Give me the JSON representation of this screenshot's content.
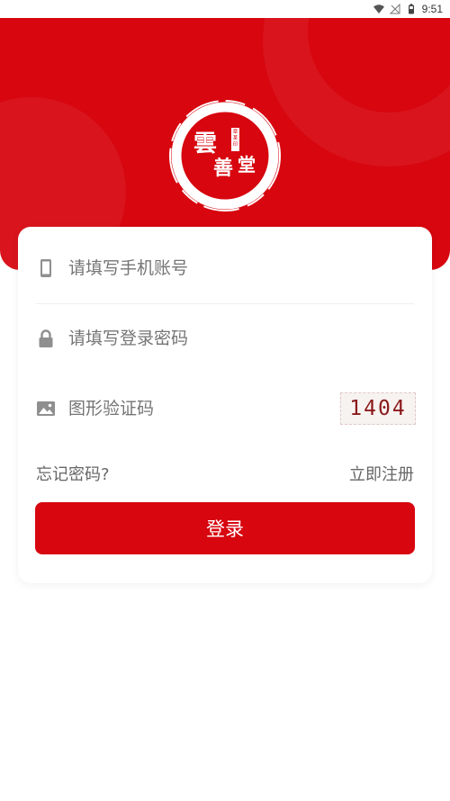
{
  "status_bar": {
    "time": "9:51"
  },
  "logo": {
    "calligraphy_main": "雲善堂",
    "calligraphy_seal": "章某印"
  },
  "form": {
    "phone_placeholder": "请填写手机账号",
    "password_placeholder": "请填写登录密码",
    "captcha_placeholder": "图形验证码",
    "captcha_code": "1404"
  },
  "links": {
    "forgot_password": "忘记密码?",
    "register": "立即注册"
  },
  "login_button": "登录",
  "colors": {
    "brand_red": "#d7060f",
    "placeholder_gray": "#999999"
  },
  "icons": {
    "phone": "phone-icon",
    "password": "lock-icon",
    "captcha": "image-icon"
  }
}
